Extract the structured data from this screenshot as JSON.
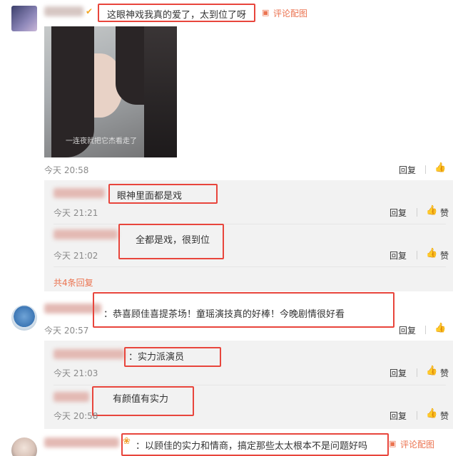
{
  "comments": [
    {
      "text": "这眼神戏我真的爱了，太到位了呀",
      "pic_link": "评论配图",
      "time": "今天 20:58",
      "reply_label": "回复",
      "image_caption": "一连夜就把它杰看走了"
    },
    {
      "text": "：恭喜顾佳喜提茶场！童瑶演技真的好棒！今晚剧情很好看",
      "time": "今天 20:57",
      "reply_label": "回复"
    },
    {
      "text": "：以顾佳的实力和情商，搞定那些太太根本不是问题好吗",
      "pic_link": "评论配图"
    }
  ],
  "replies_1": [
    {
      "text": "眼神里面都是戏",
      "time": "今天 21:21",
      "reply_label": "回复",
      "like_label": "赞"
    },
    {
      "text": "全都是戏，很到位",
      "time": "今天 21:02",
      "reply_label": "回复",
      "like_label": "赞"
    }
  ],
  "more_replies_1": "共4条回复",
  "replies_2": [
    {
      "text": "：实力派演员",
      "time": "今天 21:03",
      "reply_label": "回复",
      "like_label": "赞"
    },
    {
      "text": "有颜值有实力",
      "time": "今天 20:58",
      "reply_label": "回复",
      "like_label": "赞"
    }
  ],
  "colors": {
    "highlight": "#e8453c",
    "link": "#eb7350",
    "muted": "#8a8a8a"
  },
  "icons": {
    "like": "thumbs-up-icon",
    "picture": "picture-icon",
    "verified": "verified-badge-icon"
  }
}
